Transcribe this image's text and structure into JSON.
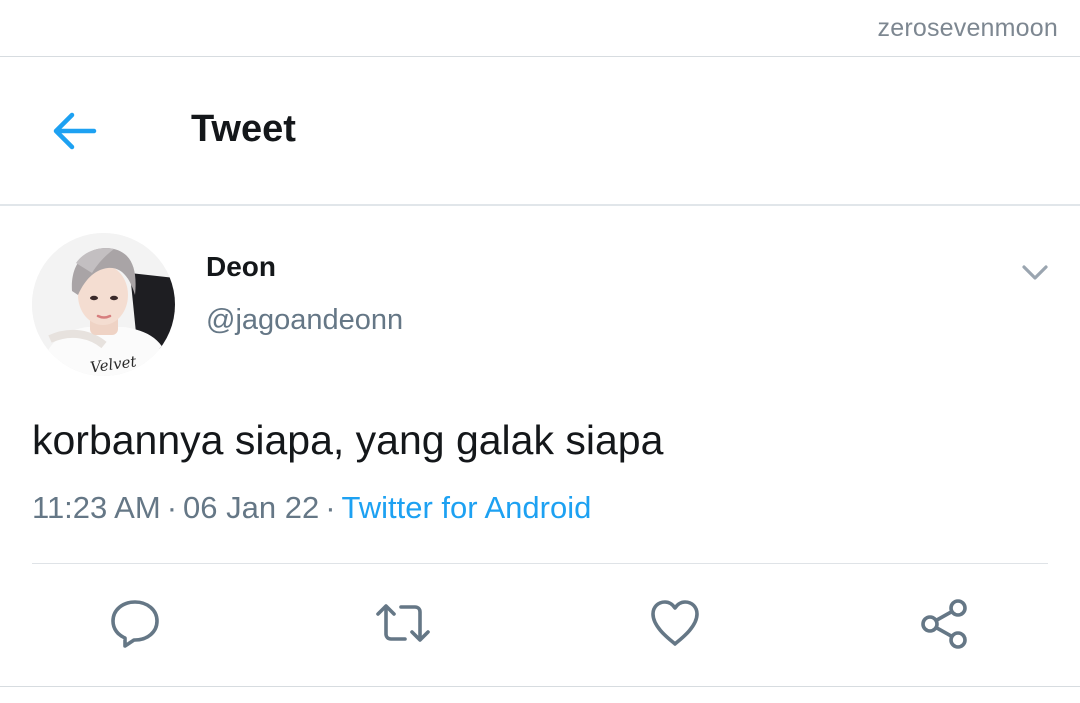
{
  "watermark": "zerosevenmoon",
  "header": {
    "title": "Tweet",
    "back_icon": "arrow-left-icon"
  },
  "tweet": {
    "author": {
      "display_name": "Deon",
      "handle": "@jagoandeonn",
      "avatar_shirt_text": "Velvet"
    },
    "text": "korbannya siapa, yang galak siapa",
    "time": "11:23 AM",
    "date": "06 Jan 22",
    "separator": "·",
    "source": "Twitter for Android"
  },
  "actions": [
    {
      "name": "reply",
      "icon": "comment-icon"
    },
    {
      "name": "retweet",
      "icon": "retweet-icon"
    },
    {
      "name": "like",
      "icon": "heart-icon"
    },
    {
      "name": "share",
      "icon": "share-icon"
    }
  ],
  "colors": {
    "accent": "#1da1f2",
    "muted": "#657786",
    "text": "#14171a",
    "icon": "#657786",
    "divider": "#e1e6ea"
  }
}
